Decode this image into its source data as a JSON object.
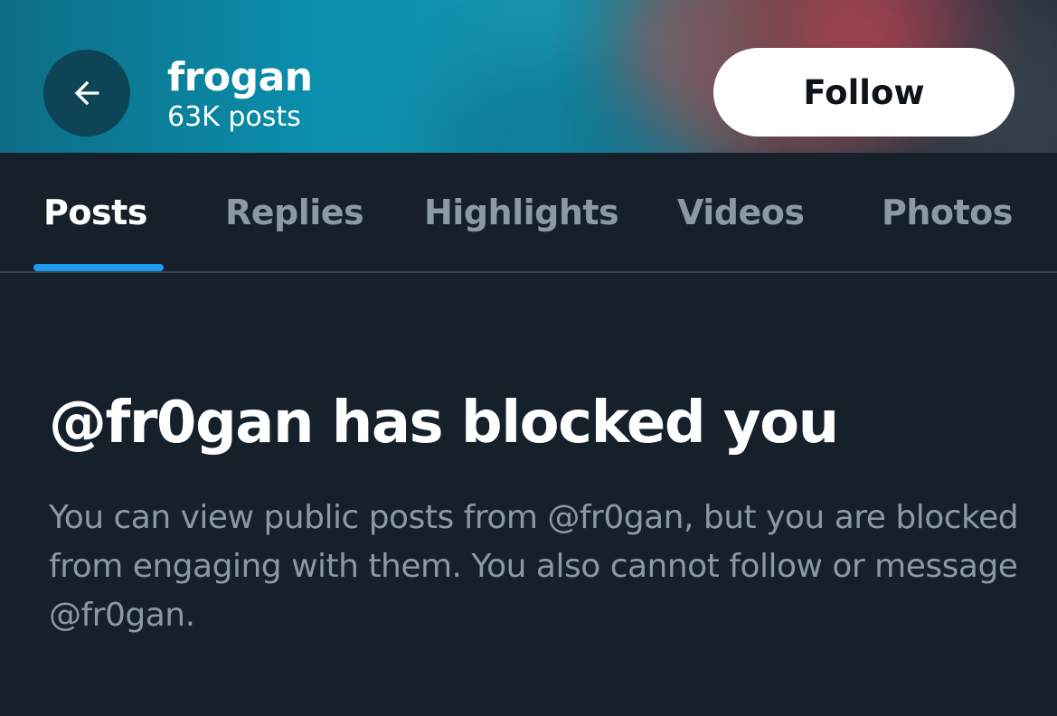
{
  "header": {
    "profile_name": "frogan",
    "post_count": "63K posts",
    "follow_label": "Follow",
    "back_icon": "arrow-left-icon"
  },
  "tabs": [
    {
      "label": "Posts",
      "active": true
    },
    {
      "label": "Replies",
      "active": false
    },
    {
      "label": "Highlights",
      "active": false
    },
    {
      "label": "Videos",
      "active": false
    },
    {
      "label": "Photos",
      "active": false
    }
  ],
  "blocked": {
    "title": "@fr0gan has blocked you",
    "body": "You can view public posts from @fr0gan, but you are blocked from engaging with them. You also cannot follow or message @fr0gan."
  },
  "colors": {
    "background": "#15202b",
    "accent": "#1d9bf0",
    "muted_text": "#8b98a5",
    "divider": "#38444d"
  }
}
